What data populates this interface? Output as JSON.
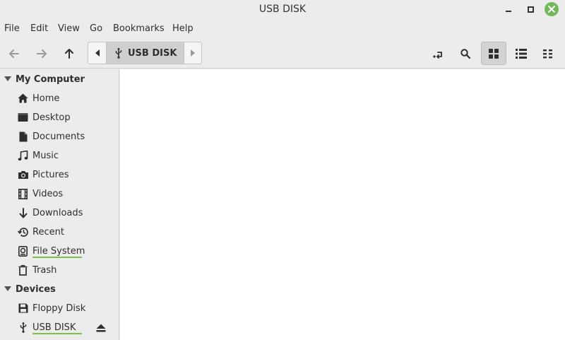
{
  "window": {
    "title": "USB DISK"
  },
  "menu": [
    "File",
    "Edit",
    "Go",
    "View",
    "Bookmarks",
    "Help"
  ],
  "menubar": {
    "file": "File",
    "edit": "Edit",
    "view": "View",
    "go": "Go",
    "bookmarks": "Bookmarks",
    "help": "Help"
  },
  "toolbar": {
    "back_icon": "arrow-left-icon",
    "forward_icon": "arrow-right-icon",
    "up_icon": "arrow-up-icon",
    "path_crumb": "USB DISK",
    "path_crumb_icon": "usb-icon",
    "toggle_location_icon": "location-toggle-icon",
    "search_icon": "search-icon",
    "view_modes": [
      "icon-view",
      "list-view",
      "compact-view"
    ],
    "active_view": "icon-view"
  },
  "sidebar": {
    "my_computer": {
      "label": "My Computer",
      "items": [
        {
          "label": "Home",
          "icon": "home-icon"
        },
        {
          "label": "Desktop",
          "icon": "desktop-icon"
        },
        {
          "label": "Documents",
          "icon": "documents-icon"
        },
        {
          "label": "Music",
          "icon": "music-icon"
        },
        {
          "label": "Pictures",
          "icon": "camera-icon"
        },
        {
          "label": "Videos",
          "icon": "film-icon"
        },
        {
          "label": "Downloads",
          "icon": "download-icon"
        },
        {
          "label": "Recent",
          "icon": "history-icon"
        },
        {
          "label": "File System",
          "icon": "disk-icon"
        },
        {
          "label": "Trash",
          "icon": "trash-icon"
        }
      ]
    },
    "devices": {
      "label": "Devices",
      "items": [
        {
          "label": "Floppy Disk",
          "icon": "floppy-icon"
        },
        {
          "label": "USB DISK",
          "icon": "usb-icon",
          "eject_icon": "eject-icon"
        }
      ]
    }
  },
  "colors": {
    "usage_bar": "#7fbf4d",
    "close_button": "#72b85a",
    "content_bg": "#ffffff"
  }
}
